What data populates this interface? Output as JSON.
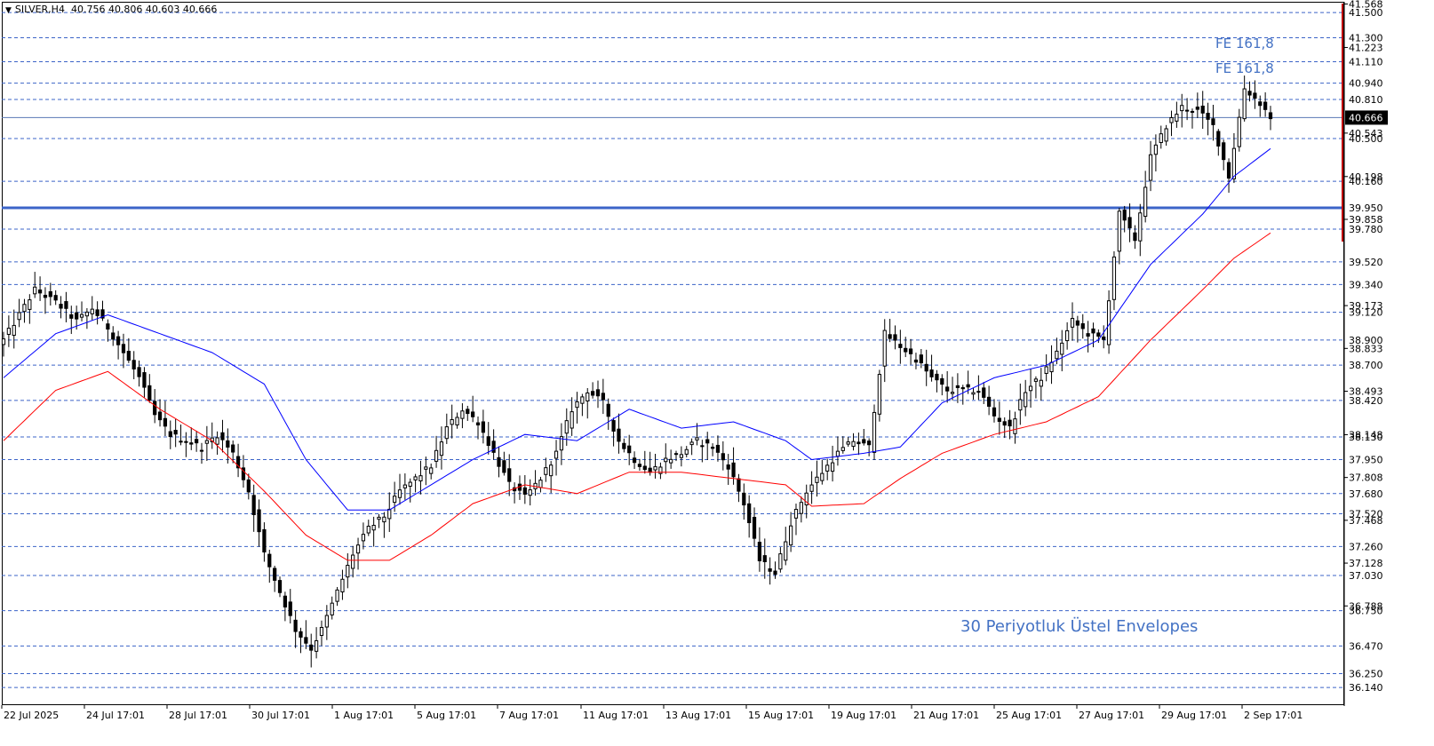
{
  "header": {
    "symbol": "SILVER,H4",
    "ohlc": "40.756 40.806 40.603 40.666"
  },
  "annotations": {
    "envelope_label": "30 Periyotluk Üstel Envelopes",
    "fe_labels": [
      "FE 161,8",
      "FE 161,8"
    ]
  },
  "colors": {
    "upper_band": "#0000ff",
    "lower_band": "#ff0000",
    "level_line": "#3c64c8",
    "key_level": "#3c64c8",
    "price_tag": "#000000",
    "annotation": "#4472c4",
    "axis_marker": "#c00000"
  },
  "chart_data": {
    "type": "candlestick",
    "symbol": "SILVER",
    "timeframe": "H4",
    "ylim": [
      36.0,
      41.6
    ],
    "y_tick_labels": [
      "41.568",
      "41.223",
      "40.543",
      "40.198",
      "39.858",
      "39.173",
      "38.833",
      "38.493",
      "38.148",
      "37.808",
      "37.468",
      "37.128",
      "36.788"
    ],
    "x_tick_labels": [
      "22 Jul 2025",
      "24 Jul 17:01",
      "28 Jul 17:01",
      "30 Jul 17:01",
      "1 Aug 17:01",
      "5 Aug 17:01",
      "7 Aug 17:01",
      "11 Aug 17:01",
      "13 Aug 17:01",
      "15 Aug 17:01",
      "19 Aug 17:01",
      "21 Aug 17:01",
      "25 Aug 17:01",
      "27 Aug 17:01",
      "29 Aug 17:01",
      "2 Sep 17:01"
    ],
    "current_price": 40.666,
    "horizontal_levels": [
      41.5,
      41.3,
      41.11,
      40.94,
      40.81,
      40.5,
      40.16,
      39.95,
      39.78,
      39.52,
      39.34,
      39.12,
      38.9,
      38.7,
      38.42,
      38.13,
      37.95,
      37.68,
      37.52,
      37.26,
      37.03,
      36.75,
      36.47,
      36.25,
      36.14
    ],
    "key_level": 39.95,
    "trend_path": [
      [
        0,
        38.9
      ],
      [
        6,
        39.3
      ],
      [
        10,
        39.2
      ],
      [
        14,
        39.05
      ],
      [
        17,
        39.15
      ],
      [
        20,
        39.0
      ],
      [
        23,
        38.8
      ],
      [
        26,
        38.6
      ],
      [
        29,
        38.3
      ],
      [
        32,
        38.15
      ],
      [
        35,
        38.1
      ],
      [
        38,
        38.05
      ],
      [
        41,
        38.15
      ],
      [
        44,
        38.0
      ],
      [
        47,
        37.7
      ],
      [
        50,
        37.2
      ],
      [
        53,
        36.9
      ],
      [
        56,
        36.6
      ],
      [
        59,
        36.45
      ],
      [
        61,
        36.6
      ],
      [
        64,
        36.9
      ],
      [
        67,
        37.2
      ],
      [
        70,
        37.4
      ],
      [
        73,
        37.5
      ],
      [
        76,
        37.7
      ],
      [
        79,
        37.8
      ],
      [
        82,
        37.9
      ],
      [
        85,
        38.2
      ],
      [
        88,
        38.35
      ],
      [
        91,
        38.25
      ],
      [
        94,
        38.0
      ],
      [
        97,
        37.75
      ],
      [
        100,
        37.65
      ],
      [
        103,
        37.8
      ],
      [
        106,
        38.0
      ],
      [
        109,
        38.35
      ],
      [
        112,
        38.5
      ],
      [
        115,
        38.4
      ],
      [
        118,
        38.1
      ],
      [
        121,
        37.95
      ],
      [
        124,
        37.85
      ],
      [
        127,
        37.95
      ],
      [
        130,
        38.0
      ],
      [
        133,
        38.1
      ],
      [
        136,
        38.05
      ],
      [
        139,
        37.9
      ],
      [
        142,
        37.6
      ],
      [
        145,
        37.15
      ],
      [
        148,
        37.05
      ],
      [
        151,
        37.45
      ],
      [
        154,
        37.7
      ],
      [
        157,
        37.85
      ],
      [
        160,
        38.0
      ],
      [
        163,
        38.1
      ],
      [
        166,
        38.05
      ],
      [
        169,
        38.95
      ],
      [
        172,
        38.85
      ],
      [
        175,
        38.75
      ],
      [
        178,
        38.6
      ],
      [
        181,
        38.5
      ],
      [
        184,
        38.5
      ],
      [
        187,
        38.5
      ],
      [
        190,
        38.3
      ],
      [
        193,
        38.2
      ],
      [
        196,
        38.5
      ],
      [
        199,
        38.6
      ],
      [
        202,
        38.8
      ],
      [
        205,
        39.05
      ],
      [
        208,
        38.95
      ],
      [
        211,
        38.9
      ],
      [
        214,
        39.9
      ],
      [
        217,
        39.7
      ],
      [
        220,
        40.35
      ],
      [
        223,
        40.6
      ],
      [
        226,
        40.75
      ],
      [
        229,
        40.72
      ],
      [
        232,
        40.6
      ],
      [
        235,
        40.2
      ],
      [
        238,
        40.9
      ],
      [
        241,
        40.78
      ],
      [
        243,
        40.67
      ]
    ],
    "upper_envelope": [
      [
        0,
        38.6
      ],
      [
        10,
        38.95
      ],
      [
        20,
        39.1
      ],
      [
        30,
        38.95
      ],
      [
        40,
        38.8
      ],
      [
        50,
        38.55
      ],
      [
        58,
        37.95
      ],
      [
        66,
        37.55
      ],
      [
        74,
        37.55
      ],
      [
        82,
        37.75
      ],
      [
        90,
        37.95
      ],
      [
        100,
        38.15
      ],
      [
        110,
        38.1
      ],
      [
        120,
        38.35
      ],
      [
        130,
        38.2
      ],
      [
        140,
        38.25
      ],
      [
        150,
        38.1
      ],
      [
        155,
        37.95
      ],
      [
        165,
        38.0
      ],
      [
        172,
        38.05
      ],
      [
        180,
        38.4
      ],
      [
        190,
        38.6
      ],
      [
        200,
        38.7
      ],
      [
        210,
        38.9
      ],
      [
        220,
        39.5
      ],
      [
        230,
        39.9
      ],
      [
        236,
        40.2
      ],
      [
        243,
        40.42
      ]
    ],
    "lower_envelope": [
      [
        0,
        38.1
      ],
      [
        10,
        38.5
      ],
      [
        20,
        38.65
      ],
      [
        30,
        38.35
      ],
      [
        40,
        38.1
      ],
      [
        50,
        37.7
      ],
      [
        58,
        37.35
      ],
      [
        66,
        37.15
      ],
      [
        74,
        37.15
      ],
      [
        82,
        37.35
      ],
      [
        90,
        37.6
      ],
      [
        100,
        37.75
      ],
      [
        110,
        37.68
      ],
      [
        120,
        37.85
      ],
      [
        130,
        37.85
      ],
      [
        140,
        37.8
      ],
      [
        150,
        37.75
      ],
      [
        155,
        37.58
      ],
      [
        165,
        37.6
      ],
      [
        172,
        37.8
      ],
      [
        180,
        38.0
      ],
      [
        190,
        38.15
      ],
      [
        200,
        38.25
      ],
      [
        210,
        38.45
      ],
      [
        220,
        38.9
      ],
      [
        230,
        39.3
      ],
      [
        236,
        39.55
      ],
      [
        243,
        39.75
      ]
    ]
  }
}
